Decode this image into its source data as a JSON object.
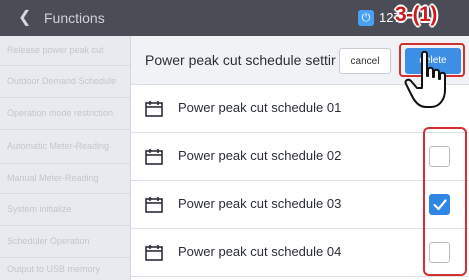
{
  "topbar": {
    "back_icon": "chevron-left-icon",
    "title": "Functions",
    "power_icon": "power-icon",
    "count": "127"
  },
  "annotation": {
    "step": "3-(1)"
  },
  "sidebar": {
    "items": [
      {
        "label": "Release power peak cut"
      },
      {
        "label": "Outdoor Demand Schedule"
      },
      {
        "label": "Operation mode restriction"
      },
      {
        "label": "Automatic Meter-Reading"
      },
      {
        "label": "Manual Meter-Reading"
      },
      {
        "label": "System initialize"
      },
      {
        "label": "Scheduler Operation"
      },
      {
        "label": "Output to USB memory"
      }
    ]
  },
  "header": {
    "title": "Power peak cut schedule settir",
    "cancel_label": "cancel",
    "delete_label": "delete"
  },
  "schedules": [
    {
      "label": "Power peak cut schedule 01",
      "checkbox": "none"
    },
    {
      "label": "Power peak cut schedule 02",
      "checkbox": "unchecked"
    },
    {
      "label": "Power peak cut schedule 03",
      "checkbox": "checked"
    },
    {
      "label": "Power peak cut schedule 04",
      "checkbox": "unchecked"
    }
  ],
  "colors": {
    "topbar": "#4a4d56",
    "accent": "#3d8fe6",
    "highlight": "#d03030"
  }
}
